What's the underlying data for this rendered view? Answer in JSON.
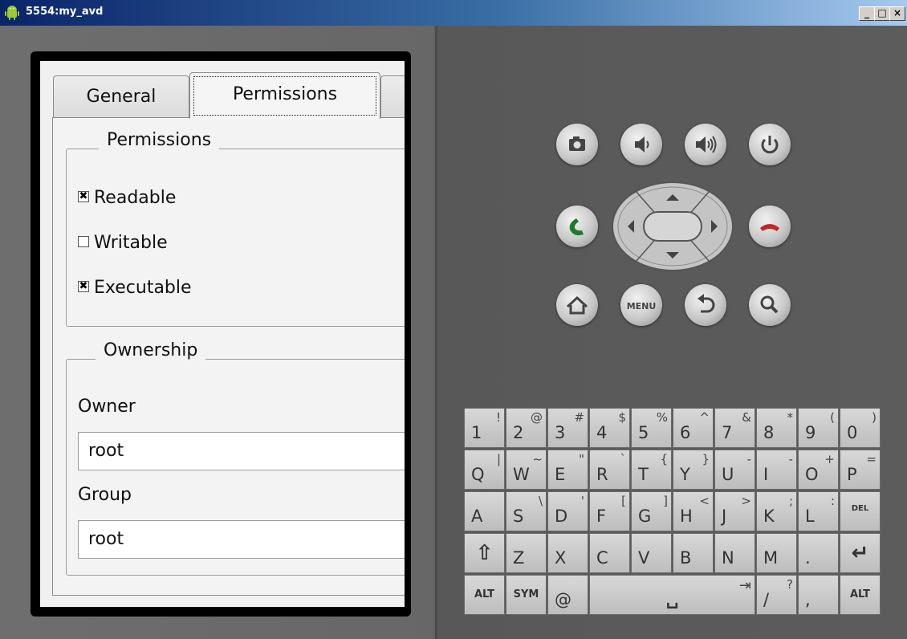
{
  "window": {
    "title": "5554:my_avd",
    "min": "_",
    "max": "□",
    "close": "×"
  },
  "tabs": [
    "General",
    "Permissions"
  ],
  "permissions": {
    "group_title": "Permissions",
    "items": [
      {
        "label": "Readable",
        "checked": true
      },
      {
        "label": "Writable",
        "checked": false
      },
      {
        "label": "Executable",
        "checked": true
      }
    ]
  },
  "ownership": {
    "group_title": "Ownership",
    "owner_label": "Owner",
    "owner_value": "root",
    "group_label": "Group",
    "group_value": "root"
  },
  "hardware": {
    "buttons": [
      "camera-icon",
      "volume-down-icon",
      "volume-up-icon",
      "power-icon",
      "call-icon",
      "end-call-icon",
      "home-icon",
      "menu-button",
      "back-icon",
      "search-icon"
    ],
    "menu_label": "MENU"
  },
  "keyboard": {
    "rows": [
      [
        [
          "1",
          "!"
        ],
        [
          "2",
          "@"
        ],
        [
          "3",
          "#"
        ],
        [
          "4",
          "$"
        ],
        [
          "5",
          "%"
        ],
        [
          "6",
          "^"
        ],
        [
          "7",
          "&"
        ],
        [
          "8",
          "*"
        ],
        [
          "9",
          "("
        ],
        [
          "0",
          ")"
        ]
      ],
      [
        [
          "Q",
          "|"
        ],
        [
          "W",
          "~"
        ],
        [
          "E",
          "\""
        ],
        [
          "R",
          "`"
        ],
        [
          "T",
          "{"
        ],
        [
          "Y",
          "}"
        ],
        [
          "U",
          "-"
        ],
        [
          "I",
          "-"
        ],
        [
          "O",
          "+"
        ],
        [
          "P",
          "="
        ]
      ],
      [
        [
          "A",
          ""
        ],
        [
          "S",
          "\\"
        ],
        [
          "D",
          "'"
        ],
        [
          "F",
          "["
        ],
        [
          "G",
          "]"
        ],
        [
          "H",
          "<"
        ],
        [
          "J",
          ">"
        ],
        [
          "K",
          ";"
        ],
        [
          "L",
          ":"
        ],
        [
          "DEL",
          ""
        ]
      ],
      [
        [
          "⇧",
          ""
        ],
        [
          "Z",
          ""
        ],
        [
          "X",
          ""
        ],
        [
          "C",
          ""
        ],
        [
          "V",
          ""
        ],
        [
          "B",
          ""
        ],
        [
          "N",
          ""
        ],
        [
          "M",
          ""
        ],
        [
          ".",
          ""
        ],
        [
          "↵",
          ""
        ]
      ]
    ],
    "bottom": {
      "alt_left": "ALT",
      "sym": "SYM",
      "at": "@",
      "space": "␣",
      "tab": "⇥",
      "slash": "/",
      "slash_alt": "?",
      "comma": ",",
      "alt_right": "ALT"
    }
  }
}
